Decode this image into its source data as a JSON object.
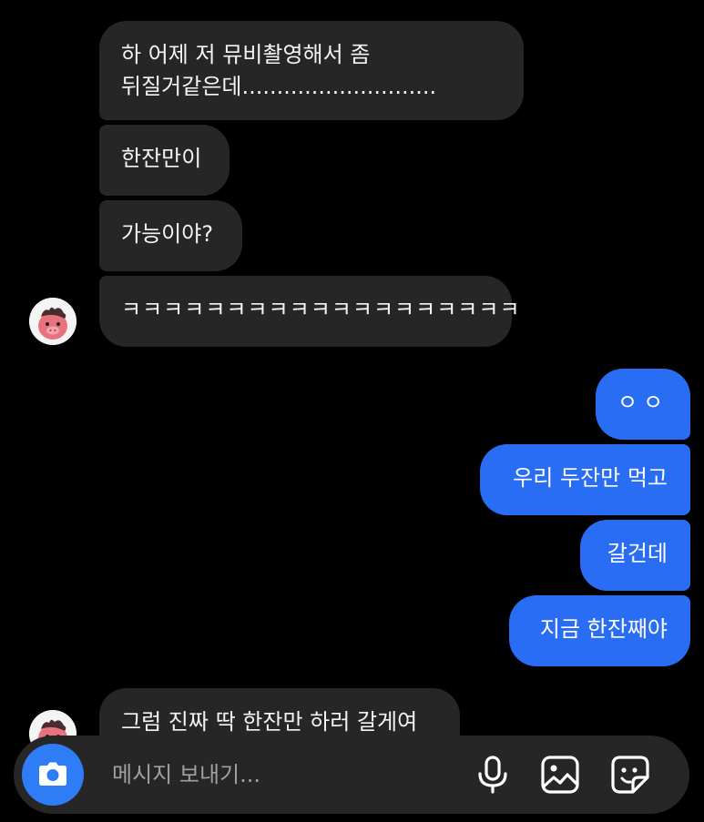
{
  "conversation": {
    "incoming_group_1": [
      "하 어제 저 뮤비촬영해서 좀 뒤질거같은데............................",
      "한잔만이",
      "가능이야?",
      "ㅋㅋㅋㅋㅋㅋㅋㅋㅋㅋㅋㅋㅋㅋㅋㅋㅋㅋㅋ"
    ],
    "outgoing_group": [
      "ㅇㅇ",
      "우리 두잔만 먹고",
      "갈건데",
      "지금 한잔째야"
    ],
    "incoming_group_2": [
      "그럼 진짜 딱 한잔만 하러 갈게여"
    ]
  },
  "composer": {
    "placeholder": "메시지 보내기...",
    "value": "",
    "icons": [
      "camera-icon",
      "microphone-icon",
      "gallery-icon",
      "sticker-icon"
    ]
  },
  "colors": {
    "background": "#000000",
    "incoming_bubble": "#262626",
    "outgoing_bubble": "#2a6df5",
    "camera_button": "#2f7df6",
    "composer": "#262626"
  }
}
